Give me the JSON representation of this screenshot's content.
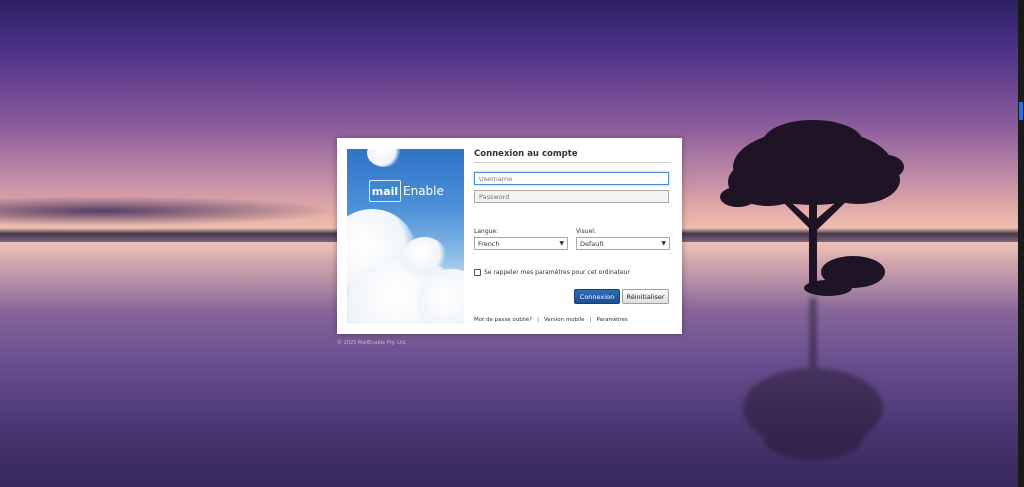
{
  "brand": {
    "logo_word_a": "mail",
    "logo_word_b": "Enable"
  },
  "login": {
    "title": "Connexion au compte",
    "username_placeholder": "Username",
    "password_placeholder": "Password",
    "language_label": "Langue:",
    "language_value": "French",
    "skin_label": "Visuel:",
    "skin_value": "Default",
    "remember_label": "Se rappeler mes paramètres pour cet ordinateur",
    "remember_checked": false,
    "login_button": "Connexion",
    "reset_button": "Réinitialiser"
  },
  "footer": {
    "forgot_password": "Mot de passe oublié?",
    "separator": "|",
    "mobile_version": "Version mobile",
    "settings": "Paramètres"
  },
  "copyright": "© 2025 MailEnable Pty. Ltd.",
  "colors": {
    "primary_button": "#1c4e8f",
    "focus_border": "#4c8fd8",
    "accent_tick": "#2d6fd8"
  },
  "icons": {
    "select_arrow": "chevron-down-icon",
    "logo": "envelope-icon"
  }
}
